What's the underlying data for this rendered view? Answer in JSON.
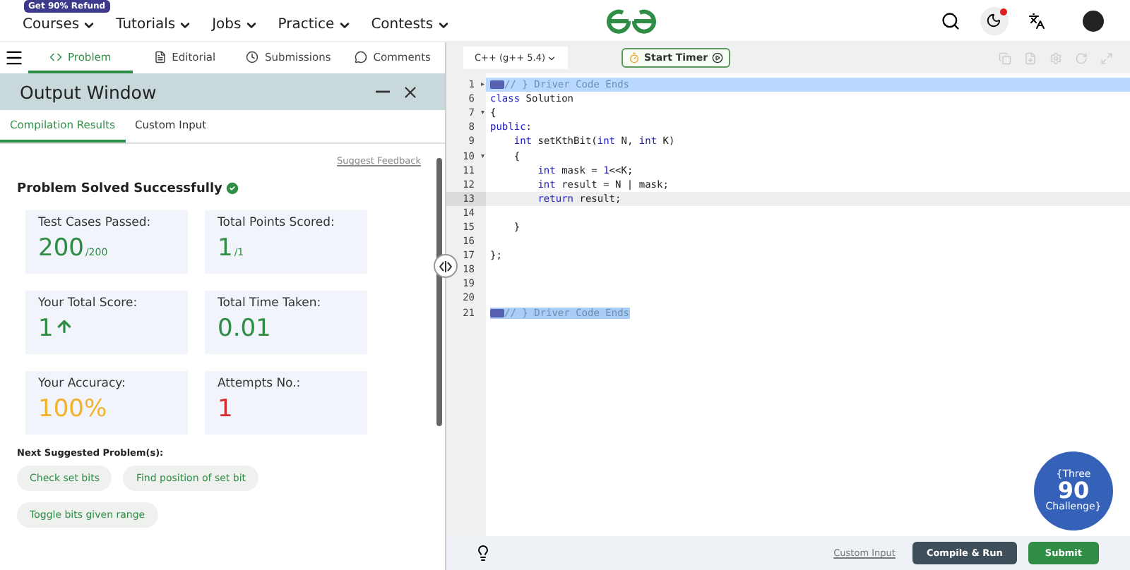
{
  "top_nav": {
    "badge": "Get 90% Refund",
    "menus": [
      {
        "label": "Courses"
      },
      {
        "label": "Tutorials"
      },
      {
        "label": "Jobs"
      },
      {
        "label": "Practice"
      },
      {
        "label": "Contests"
      }
    ],
    "dark_mode_dot": true
  },
  "problem_tabs": [
    {
      "label": "Problem",
      "selected": true
    },
    {
      "label": "Editorial",
      "selected": false
    },
    {
      "label": "Submissions",
      "selected": false
    },
    {
      "label": "Comments",
      "selected": false
    }
  ],
  "output_window": {
    "title": "Output Window",
    "tabs": [
      {
        "label": "Compilation Results",
        "selected": true
      },
      {
        "label": "Custom Input",
        "selected": false
      }
    ],
    "feedback_link": "Suggest Feedback",
    "status": "Problem Solved Successfully",
    "stats": [
      {
        "kind": "total",
        "label": "Test Cases Passed:",
        "value": "200",
        "suffix": "/200",
        "color": "#2f8d46"
      },
      {
        "kind": "total",
        "label": "Total Points Scored:",
        "value": "1",
        "suffix": "/1",
        "color": "#2f8d46"
      },
      {
        "kind": "rising",
        "label": "Your Total Score:",
        "value": "1",
        "color": "#2f8d46"
      },
      {
        "kind": "plain",
        "label": "Total Time Taken:",
        "value": "0.01",
        "color": "#2f8d46"
      },
      {
        "kind": "plain",
        "label": "Your Accuracy:",
        "value": "100%",
        "color": "#f2b230"
      },
      {
        "kind": "plain",
        "label": "Attempts No.:",
        "value": "1",
        "color": "#d82b2b"
      }
    ],
    "suggested_title": "Next Suggested Problem(s):",
    "suggested": [
      {
        "label": "Check set bits"
      },
      {
        "label": "Find position of set bit"
      },
      {
        "label": "Toggle bits given range"
      }
    ]
  },
  "editor": {
    "language": "C++ (g++ 5.4)",
    "timer_button": "Start Timer",
    "lines": [
      {
        "number": "1",
        "marker": "▸",
        "highlighted": true,
        "current": false,
        "folded_chip": true,
        "segments": [
          {
            "text": "// } Driver Code Ends",
            "kind": "comment"
          }
        ]
      },
      {
        "number": "6",
        "current": false,
        "segments": [
          {
            "text": "class",
            "kind": "keyword"
          },
          {
            "text": " Solution",
            "kind": "plain"
          }
        ]
      },
      {
        "number": "7",
        "marker": "▾",
        "current": false,
        "segments": [
          {
            "text": "{",
            "kind": "plain"
          }
        ]
      },
      {
        "number": "8",
        "current": false,
        "segments": [
          {
            "text": "public",
            "kind": "keyword"
          },
          {
            "text": ":",
            "kind": "plain"
          }
        ]
      },
      {
        "number": "9",
        "current": false,
        "segments": [
          {
            "text": "    int",
            "kind": "keyword"
          },
          {
            "text": " setKthBit(",
            "kind": "plain"
          },
          {
            "text": "int",
            "kind": "keyword"
          },
          {
            "text": " N, ",
            "kind": "plain"
          },
          {
            "text": "int",
            "kind": "keyword"
          },
          {
            "text": " K)",
            "kind": "plain"
          }
        ]
      },
      {
        "number": "10",
        "marker": "▾",
        "current": false,
        "segments": [
          {
            "text": "    {",
            "kind": "plain"
          }
        ]
      },
      {
        "number": "11",
        "current": false,
        "segments": [
          {
            "text": "        int",
            "kind": "keyword"
          },
          {
            "text": " mask = ",
            "kind": "plain"
          },
          {
            "text": "1",
            "kind": "number"
          },
          {
            "text": "<<K;",
            "kind": "plain"
          }
        ]
      },
      {
        "number": "12",
        "current": false,
        "segments": [
          {
            "text": "        int",
            "kind": "keyword"
          },
          {
            "text": " result = N | mask;",
            "kind": "plain"
          }
        ]
      },
      {
        "number": "13",
        "current": true,
        "segments": [
          {
            "text": "        return",
            "kind": "keyword"
          },
          {
            "text": " result;",
            "kind": "plain"
          }
        ]
      },
      {
        "number": "14",
        "current": false
      },
      {
        "number": "15",
        "current": false,
        "segments": [
          {
            "text": "    }",
            "kind": "plain"
          }
        ]
      },
      {
        "number": "16",
        "current": false
      },
      {
        "number": "17",
        "current": false,
        "segments": [
          {
            "text": "};",
            "kind": "plain"
          }
        ]
      },
      {
        "number": "18",
        "current": false
      },
      {
        "number": "19",
        "current": false
      },
      {
        "number": "20",
        "current": false
      },
      {
        "number": "21",
        "selected": true,
        "current": false,
        "folded_chip": true,
        "segments": [
          {
            "text": "// } Driver Code Ends",
            "kind": "comment"
          }
        ]
      }
    ],
    "custom_input": "Custom Input",
    "compile_button": "Compile & Run",
    "submit_button": "Submit",
    "challenge_badge": {
      "top": "{Three",
      "number": "90",
      "bottom": "Challenge}"
    }
  }
}
